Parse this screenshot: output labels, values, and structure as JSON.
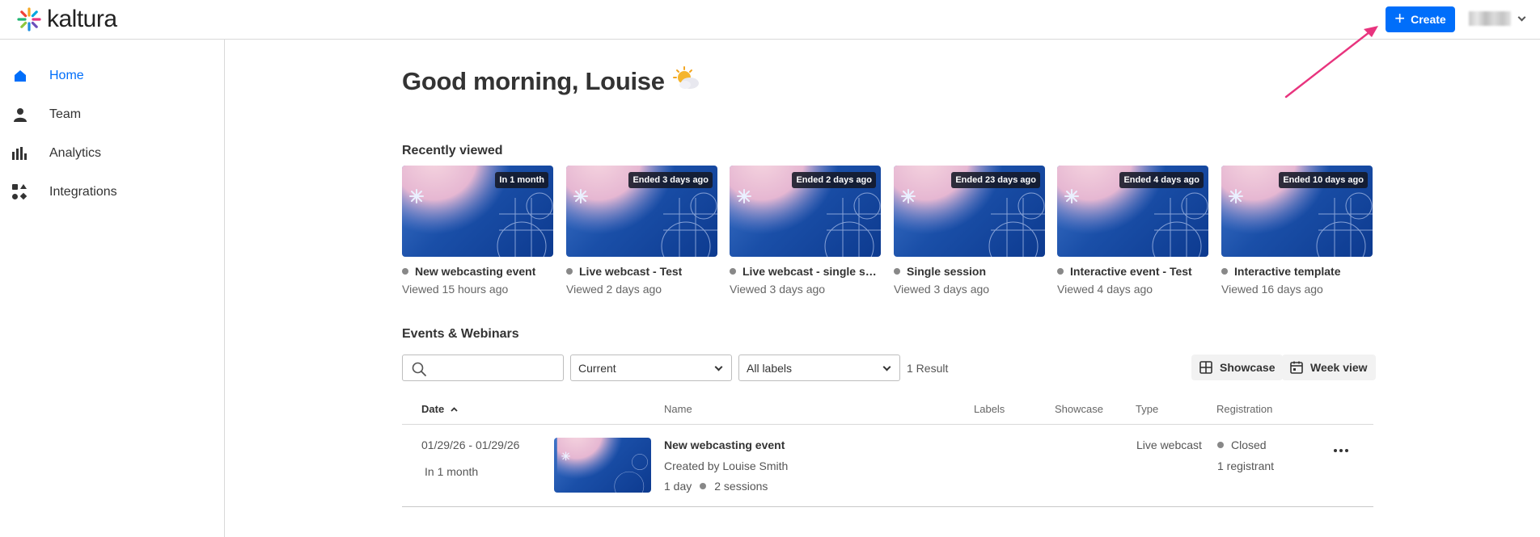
{
  "app": {
    "logo_text": "kaltura"
  },
  "header": {
    "create_label": "Create"
  },
  "sidebar": {
    "items": [
      {
        "label": "Home",
        "icon": "home-icon",
        "active": true
      },
      {
        "label": "Team",
        "icon": "person-icon",
        "active": false
      },
      {
        "label": "Analytics",
        "icon": "bar-chart-icon",
        "active": false
      },
      {
        "label": "Integrations",
        "icon": "integrations-icon",
        "active": false
      }
    ]
  },
  "main": {
    "greeting": "Good morning, Louise",
    "greeting_icon": "sun-cloud-icon",
    "recently_viewed_title": "Recently viewed",
    "recent": [
      {
        "badge": "In 1 month",
        "title": "New webcasting event",
        "viewed": "Viewed 15 hours ago"
      },
      {
        "badge": "Ended 3 days ago",
        "title": "Live webcast - Test",
        "viewed": "Viewed 2 days ago"
      },
      {
        "badge": "Ended 2 days ago",
        "title": "Live webcast - single session",
        "viewed": "Viewed 3 days ago"
      },
      {
        "badge": "Ended 23 days ago",
        "title": "Single session",
        "viewed": "Viewed 3 days ago"
      },
      {
        "badge": "Ended 4 days ago",
        "title": "Interactive event - Test",
        "viewed": "Viewed 4 days ago"
      },
      {
        "badge": "Ended 10 days ago",
        "title": "Interactive template",
        "viewed": "Viewed 16 days ago"
      }
    ],
    "events_title": "Events & Webinars",
    "filters": {
      "search_value": "",
      "status_select": "Current",
      "labels_select": "All labels",
      "result_count": "1 Result",
      "showcase_label": "Showcase",
      "week_view_label": "Week view"
    },
    "table": {
      "headers": {
        "date": "Date",
        "name": "Name",
        "labels": "Labels",
        "showcase": "Showcase",
        "type": "Type",
        "registration": "Registration"
      },
      "rows": [
        {
          "date_range": "01/29/26 - 01/29/26",
          "relative": "In 1 month",
          "name": "New webcasting event",
          "created_by": "Created by Louise Smith",
          "duration": "1 day",
          "sessions": "2 sessions",
          "type": "Live webcast",
          "registration_status": "Closed",
          "registrants": "1 registrant"
        }
      ]
    }
  },
  "colors": {
    "accent": "#006efa",
    "arrow": "#e8347e"
  }
}
